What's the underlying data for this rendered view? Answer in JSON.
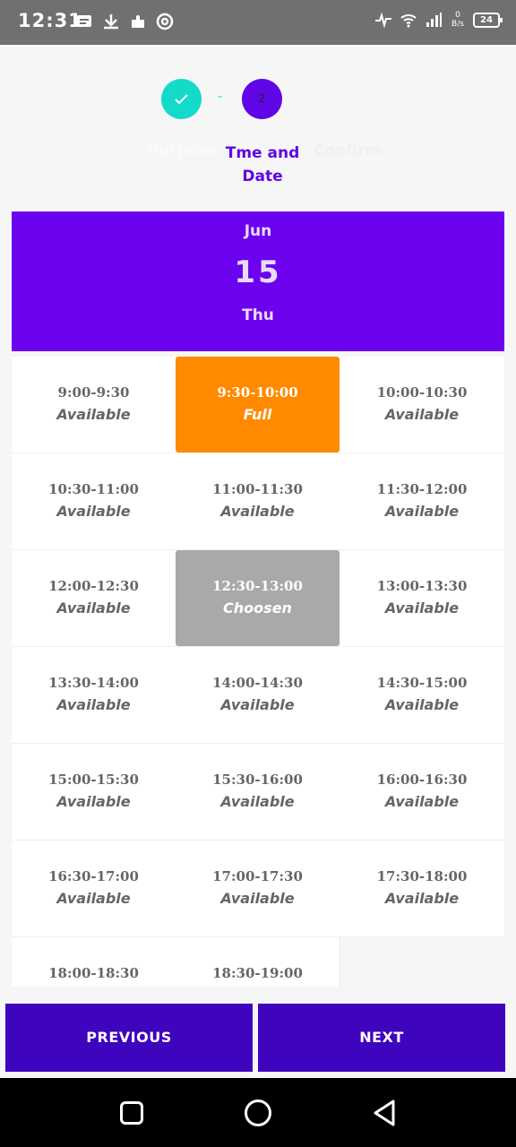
{
  "status_bar": {
    "time": "12:31",
    "icons_left": [
      "message-icon",
      "usb-icon",
      "puzzle-icon",
      "at-icon"
    ],
    "icons_right": [
      "activity-icon",
      "wifi-icon",
      "signal-icon"
    ],
    "speed_value": "0",
    "speed_unit": "B/s",
    "battery": "24"
  },
  "stepper": {
    "step1_label": "Purpose",
    "step2_number": "2",
    "step2_label": "Tme and Date",
    "step3_label": "Confirm",
    "divider": "-",
    "colors": {
      "done": "#14dbc9",
      "active": "#5f05e6"
    }
  },
  "date": {
    "month": "Jun",
    "day": "15",
    "weekday": "Thu",
    "color": "#6c02ee"
  },
  "slots": [
    {
      "time": "9:00-9:30",
      "status": "Available",
      "state": "available"
    },
    {
      "time": "9:30-10:00",
      "status": "Full",
      "state": "full"
    },
    {
      "time": "10:00-10:30",
      "status": "Available",
      "state": "available"
    },
    {
      "time": "10:30-11:00",
      "status": "Available",
      "state": "available"
    },
    {
      "time": "11:00-11:30",
      "status": "Available",
      "state": "available"
    },
    {
      "time": "11:30-12:00",
      "status": "Available",
      "state": "available"
    },
    {
      "time": "12:00-12:30",
      "status": "Available",
      "state": "available"
    },
    {
      "time": "12:30-13:00",
      "status": "Choosen",
      "state": "chosen"
    },
    {
      "time": "13:00-13:30",
      "status": "Available",
      "state": "available"
    },
    {
      "time": "13:30-14:00",
      "status": "Available",
      "state": "available"
    },
    {
      "time": "14:00-14:30",
      "status": "Available",
      "state": "available"
    },
    {
      "time": "14:30-15:00",
      "status": "Available",
      "state": "available"
    },
    {
      "time": "15:00-15:30",
      "status": "Available",
      "state": "available"
    },
    {
      "time": "15:30-16:00",
      "status": "Available",
      "state": "available"
    },
    {
      "time": "16:00-16:30",
      "status": "Available",
      "state": "available"
    },
    {
      "time": "16:30-17:00",
      "status": "Available",
      "state": "available"
    },
    {
      "time": "17:00-17:30",
      "status": "Available",
      "state": "available"
    },
    {
      "time": "17:30-18:00",
      "status": "Available",
      "state": "available"
    },
    {
      "time": "18:00-18:30",
      "status": "",
      "state": "available"
    },
    {
      "time": "18:30-19:00",
      "status": "",
      "state": "available"
    }
  ],
  "buttons": {
    "previous": "PREVIOUS",
    "next": "NEXT",
    "color": "#3f04bd"
  },
  "colors": {
    "full": "#ff8a00",
    "chosen": "#a9a9a9"
  }
}
